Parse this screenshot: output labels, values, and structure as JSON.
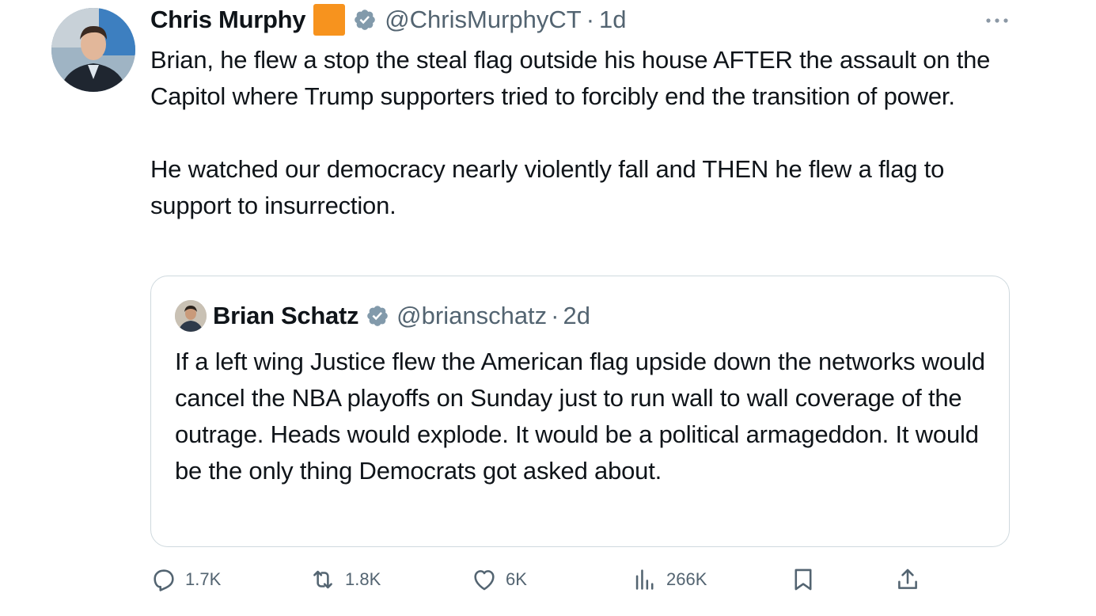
{
  "tweet": {
    "author": {
      "display_name": "Chris Murphy",
      "handle": "@ChrisMurphyCT",
      "time": "1d",
      "separator": "·"
    },
    "text": "Brian, he flew a stop the steal flag outside his house AFTER the assault on the Capitol where Trump supporters tried to forcibly end the transition of power.\n\nHe watched our democracy nearly violently fall and THEN he flew a flag to support to insurrection.",
    "quoted": {
      "author": {
        "display_name": "Brian Schatz",
        "handle": "@brianschatz",
        "time": "2d",
        "separator": "·"
      },
      "text": "If a left wing Justice flew the American flag upside down the networks would cancel the NBA playoffs on Sunday  just to run wall to wall coverage of the outrage. Heads would explode. It would be a political armageddon. It would be the only thing Democrats got asked about."
    },
    "actions": {
      "replies": "1.7K",
      "reposts": "1.8K",
      "likes": "6K",
      "views": "266K"
    }
  },
  "icons": {
    "more": "more-horizontal-icon",
    "verified": "verified-badge-icon",
    "reply": "reply-icon",
    "repost": "repost-icon",
    "like": "heart-icon",
    "views": "analytics-icon",
    "bookmark": "bookmark-icon",
    "share": "share-icon"
  },
  "colors": {
    "text": "#0f1419",
    "secondary": "#536471",
    "border": "#cfd9de",
    "verified": "#829aab",
    "emoji_square": "#f7931e"
  }
}
